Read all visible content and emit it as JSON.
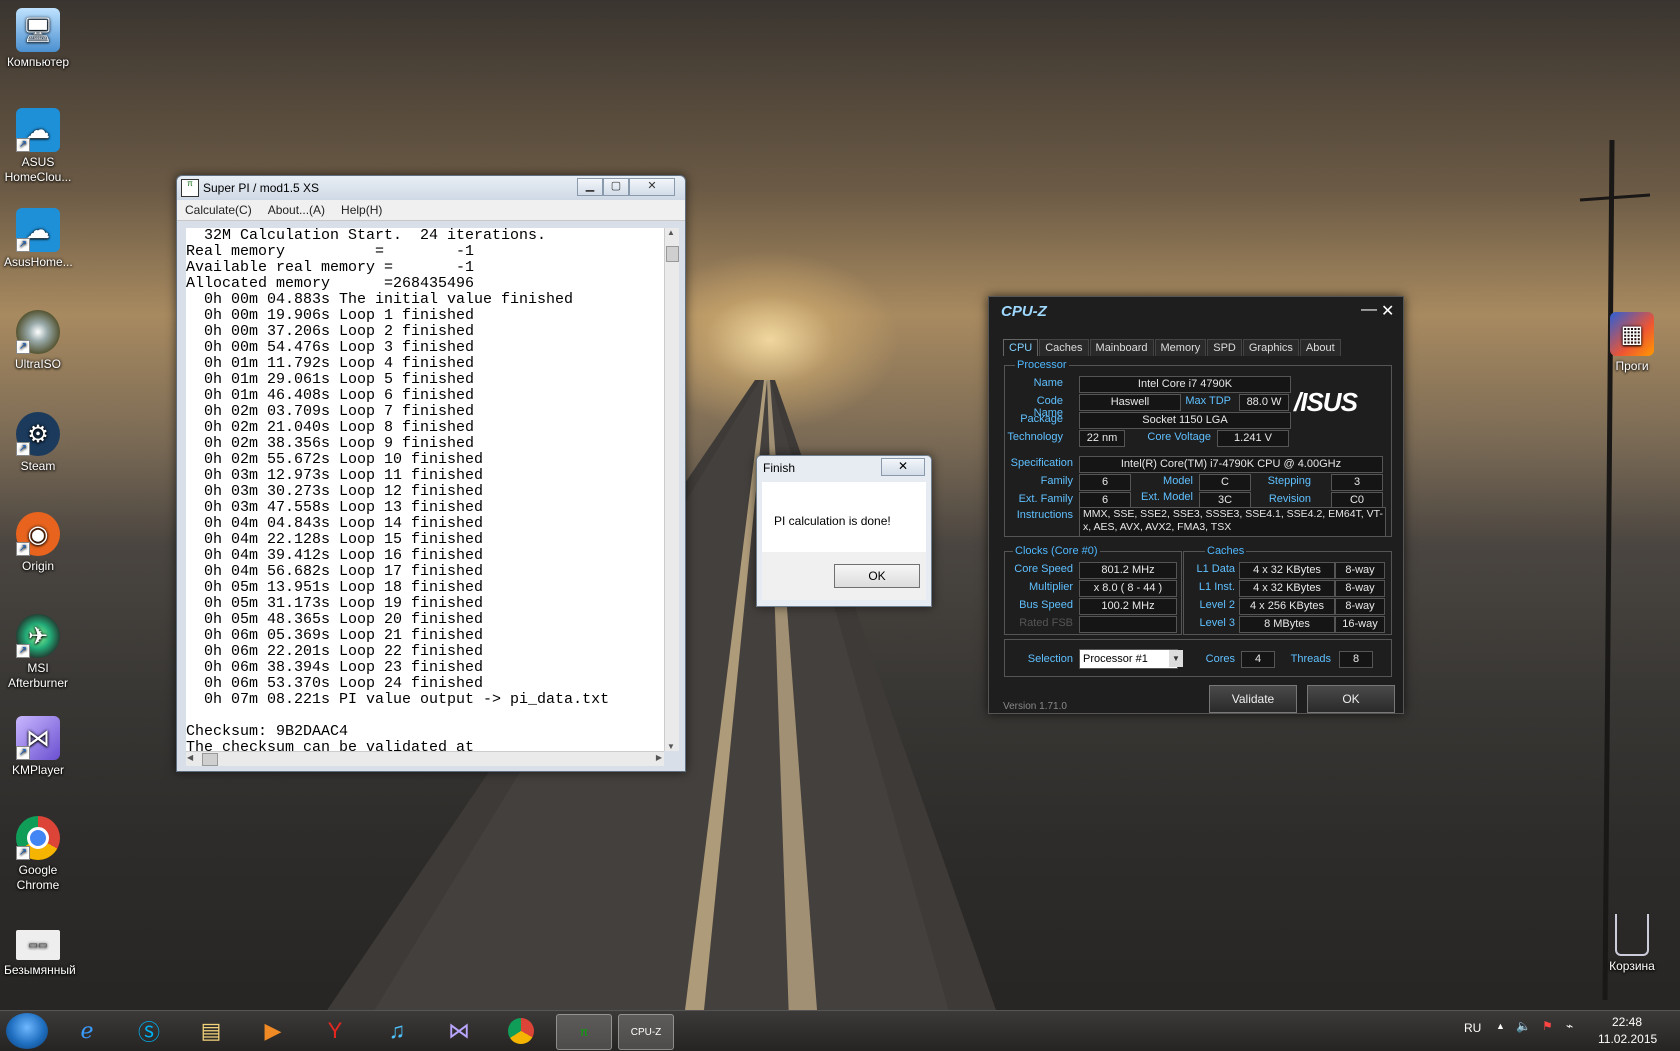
{
  "desktop": {
    "icons": [
      {
        "label": "Компьютер",
        "icon": "computer-icon"
      },
      {
        "label": "ASUS HomeClou...",
        "icon": "asus-homecloud-icon"
      },
      {
        "label": "AsusHome...",
        "icon": "asus-homecloud-icon"
      },
      {
        "label": "UltraISO",
        "icon": "ultraiso-icon"
      },
      {
        "label": "Steam",
        "icon": "steam-icon"
      },
      {
        "label": "Origin",
        "icon": "origin-icon"
      },
      {
        "label": "MSI Afterburner",
        "icon": "msi-afterburner-icon"
      },
      {
        "label": "KMPlayer",
        "icon": "kmplayer-icon"
      },
      {
        "label": "Google Chrome",
        "icon": "chrome-icon"
      },
      {
        "label": "Безымянный",
        "icon": "image-file-icon"
      }
    ],
    "right_icons": [
      {
        "label": "Проги",
        "icon": "folder-icon"
      },
      {
        "label": "Корзина",
        "icon": "recycle-bin-icon"
      }
    ]
  },
  "superpi": {
    "title": "Super PI / mod1.5 XS",
    "menu": [
      "Calculate(C)",
      "About...(A)",
      "Help(H)"
    ],
    "lines": [
      "  32M Calculation Start.  24 iterations.",
      "Real memory          =        -1",
      "Available real memory =       -1",
      "Allocated memory      =268435496",
      "  0h 00m 04.883s The initial value finished",
      "  0h 00m 19.906s Loop 1 finished",
      "  0h 00m 37.206s Loop 2 finished",
      "  0h 00m 54.476s Loop 3 finished",
      "  0h 01m 11.792s Loop 4 finished",
      "  0h 01m 29.061s Loop 5 finished",
      "  0h 01m 46.408s Loop 6 finished",
      "  0h 02m 03.709s Loop 7 finished",
      "  0h 02m 21.040s Loop 8 finished",
      "  0h 02m 38.356s Loop 9 finished",
      "  0h 02m 55.672s Loop 10 finished",
      "  0h 03m 12.973s Loop 11 finished",
      "  0h 03m 30.273s Loop 12 finished",
      "  0h 03m 47.558s Loop 13 finished",
      "  0h 04m 04.843s Loop 14 finished",
      "  0h 04m 22.128s Loop 15 finished",
      "  0h 04m 39.412s Loop 16 finished",
      "  0h 04m 56.682s Loop 17 finished",
      "  0h 05m 13.951s Loop 18 finished",
      "  0h 05m 31.173s Loop 19 finished",
      "  0h 05m 48.365s Loop 20 finished",
      "  0h 06m 05.369s Loop 21 finished",
      "  0h 06m 22.201s Loop 22 finished",
      "  0h 06m 38.394s Loop 23 finished",
      "  0h 06m 53.370s Loop 24 finished",
      "  0h 07m 08.221s PI value output -> pi_data.txt",
      "",
      "Checksum: 9B2DAAC4",
      "The checksum can be validated at"
    ]
  },
  "finish": {
    "title": "Finish",
    "message": "PI calculation is done!",
    "ok": "OK",
    "close": "✕"
  },
  "cpuz": {
    "title": "CPU-Z",
    "tabs": [
      "CPU",
      "Caches",
      "Mainboard",
      "Memory",
      "SPD",
      "Graphics",
      "About"
    ],
    "processor": {
      "group": "Processor",
      "name_label": "Name",
      "name": "Intel Core i7 4790K",
      "codename_label": "Code Name",
      "codename": "Haswell",
      "maxtdp_label": "Max TDP",
      "maxtdp": "88.0 W",
      "package_label": "Package",
      "package": "Socket 1150 LGA",
      "technology_label": "Technology",
      "technology": "22 nm",
      "corevoltage_label": "Core Voltage",
      "corevoltage": "1.241 V",
      "spec_label": "Specification",
      "spec": "Intel(R) Core(TM) i7-4790K CPU @ 4.00GHz",
      "family_label": "Family",
      "family": "6",
      "model_label": "Model",
      "model": "C",
      "stepping_label": "Stepping",
      "stepping": "3",
      "extfamily_label": "Ext. Family",
      "extfamily": "6",
      "extmodel_label": "Ext. Model",
      "extmodel": "3C",
      "revision_label": "Revision",
      "revision": "C0",
      "instructions_label": "Instructions",
      "instructions": "MMX, SSE, SSE2, SSE3, SSSE3, SSE4.1, SSE4.2, EM64T, VT-x, AES, AVX, AVX2, FMA3, TSX",
      "brand": "/ISUS"
    },
    "clocks": {
      "group": "Clocks (Core #0)",
      "corespeed_label": "Core Speed",
      "corespeed": "801.2 MHz",
      "multiplier_label": "Multiplier",
      "multiplier": "x 8.0 ( 8 - 44 )",
      "busspeed_label": "Bus Speed",
      "busspeed": "100.2 MHz",
      "ratedfsb_label": "Rated FSB",
      "ratedfsb": ""
    },
    "caches": {
      "group": "Caches",
      "l1d_label": "L1 Data",
      "l1d": "4 x 32 KBytes",
      "l1d_way": "8-way",
      "l1i_label": "L1 Inst.",
      "l1i": "4 x 32 KBytes",
      "l1i_way": "8-way",
      "l2_label": "Level 2",
      "l2": "4 x 256 KBytes",
      "l2_way": "8-way",
      "l3_label": "Level 3",
      "l3": "8 MBytes",
      "l3_way": "16-way"
    },
    "selection_label": "Selection",
    "selection": "Processor #1",
    "cores_label": "Cores",
    "cores": "4",
    "threads_label": "Threads",
    "threads": "8",
    "version": "Version 1.71.0",
    "validate": "Validate",
    "ok": "OK"
  },
  "taskbar": {
    "items": [
      "ie-icon",
      "skype-icon",
      "explorer-icon",
      "media-player-icon",
      "yandex-icon",
      "itunes-icon",
      "kmplayer-icon",
      "chrome-icon",
      "superpi-icon",
      "cpuz-icon"
    ],
    "lang": "RU",
    "time": "22:48",
    "date": "11.02.2015"
  }
}
